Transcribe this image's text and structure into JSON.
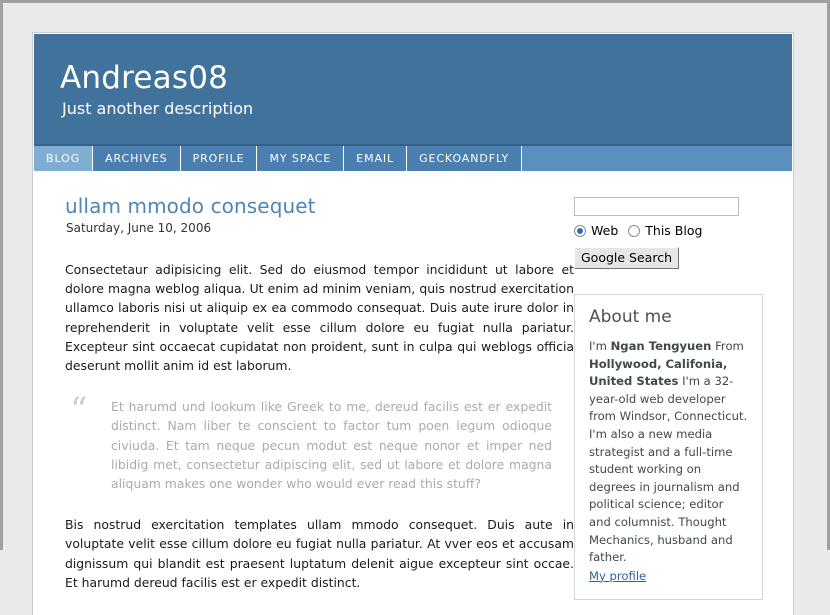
{
  "site": {
    "title": "Andreas08",
    "description": "Just another description",
    "header_bg": "#41729c",
    "nav_bg": "#5b8fc0",
    "nav_item_bg": "#4a7fb0",
    "nav_active_bg": "#7fadd4",
    "link_color": "#4f86b8"
  },
  "nav": {
    "items": [
      {
        "label": "BLOG",
        "active": true
      },
      {
        "label": "ARCHIVES",
        "active": false
      },
      {
        "label": "PROFILE",
        "active": false
      },
      {
        "label": "MY SPACE",
        "active": false
      },
      {
        "label": "EMAIL",
        "active": false
      },
      {
        "label": "GECKOANDFLY",
        "active": false
      }
    ]
  },
  "post": {
    "title": "ullam mmodo consequet",
    "date": "Saturday, June 10, 2006",
    "paragraph1": "Consectetaur adipisicing elit. Sed do eiusmod tempor incididunt ut labore et dolore magna weblog aliqua. Ut enim ad minim veniam, quis nostrud exercitation ullamco laboris nisi ut aliquip ex ea commodo consequat. Duis aute irure dolor in reprehenderit in voluptate velit esse cillum dolore eu fugiat nulla pariatur. Excepteur sint occaecat cupidatat non proident, sunt in culpa qui weblogs officia deserunt mollit anim id est laborum.",
    "quote_mark": "“",
    "quote": "Et harumd und lookum like Greek to me, dereud facilis est er expedit distinct. Nam liber te conscient to factor tum poen legum odioque civiuda. Et tam neque pecun modut est neque nonor et imper ned libidig met, consectetur adipiscing elit, sed ut labore et dolore magna aliquam makes one wonder who would ever read this stuff?",
    "paragraph2": "Bis nostrud exercitation templates ullam mmodo consequet. Duis aute in voluptate velit esse cillum dolore eu fugiat nulla pariatur. At vver eos et accusam dignissum qui blandit est praesent luptatum delenit aigue excepteur sint occae. Et harumd dereud facilis est er expedit distinct."
  },
  "search": {
    "value": "",
    "placeholder": "",
    "option_web": "Web",
    "option_this_blog": "This Blog",
    "web_selected": true,
    "button_label": "Google Search"
  },
  "about": {
    "title": "About me",
    "intro": "I'm ",
    "name": "Ngan Tengyuen",
    "from": " From ",
    "location": "Hollywood, Califonia, United States",
    "bio": " I'm a 32-year-old web developer from Windsor, Connecticut. I'm also a new media strategist and a full-time student working on degrees in journalism and political science; editor and columnist. Thought Mechanics, husband and father.",
    "profile_link": "My profile"
  }
}
